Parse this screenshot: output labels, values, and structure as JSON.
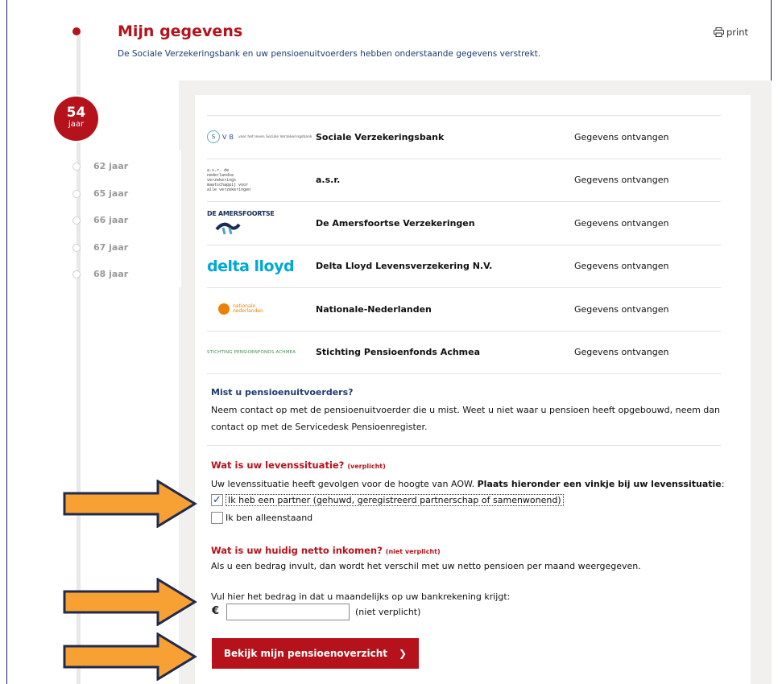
{
  "header": {
    "title": "Mijn gegevens",
    "subtitle": "De Sociale Verzekeringsbank en uw pensioenuitvoerders hebben onderstaande gegevens verstrekt.",
    "print_label": "print"
  },
  "timeline": {
    "current_age": "54",
    "current_unit": "jaar",
    "ages": [
      "62 jaar",
      "65 jaar",
      "66 jaar",
      "67 jaar",
      "68 jaar"
    ]
  },
  "providers": [
    {
      "logo": "svb-logo",
      "name": "Sociale Verzekeringsbank",
      "status": "Gegevens ontvangen"
    },
    {
      "logo": "asr-logo",
      "name": "a.s.r.",
      "status": "Gegevens ontvangen"
    },
    {
      "logo": "amersfoortse-logo",
      "name": "De Amersfoortse Verzekeringen",
      "status": "Gegevens ontvangen"
    },
    {
      "logo": "delta-lloyd-logo",
      "name": "Delta Lloyd Levensverzekering N.V.",
      "status": "Gegevens ontvangen"
    },
    {
      "logo": "nn-logo",
      "name": "Nationale-Nederlanden",
      "status": "Gegevens ontvangen"
    },
    {
      "logo": "achmea-logo",
      "name": "Stichting Pensioenfonds Achmea",
      "status": "Gegevens ontvangen"
    }
  ],
  "logos": {
    "svb_letters": [
      "S",
      "V",
      "B"
    ],
    "svb_small": "voor het leven Sociale Verzekeringsbank",
    "asr_text": "a.s.r. de nederlandse verzekerings maatschappij voor alle verzekeringen",
    "amersfoortse_text": "DE AMERSFOORTSE",
    "delta_text": "delta lloyd",
    "nn_text": "nationale nederlanden",
    "achmea_text": "STICHTING PENSIOENFONDS ACHMEA"
  },
  "missing": {
    "heading": "Mist u pensioenuitvoerders?",
    "body": "Neem contact op met de pensioenuitvoerder die u mist. Weet u niet waar u pensioen heeft opgebouwd, neem dan contact op met de Servicedesk Pensioenregister."
  },
  "life_situation": {
    "heading": "Wat is uw levenssituatie?",
    "required": "(verplicht)",
    "body_normal": "Uw levenssituatie heeft gevolgen voor de hoogte van AOW. ",
    "body_bold": "Plaats hieronder een vinkje bij uw levenssituatie",
    "body_end": ":",
    "option_partner": "Ik heb een partner (gehuwd, geregistreerd partnerschap of samenwonend)",
    "option_partner_checked": true,
    "option_single": "Ik ben alleenstaand",
    "option_single_checked": false,
    "check_mark": "✓"
  },
  "income": {
    "heading": "Wat is uw huidig netto inkomen?",
    "optional": "(niet verplicht)",
    "body": "Als u een bedrag invult, dan wordt het verschil met uw netto pensioen per maand weergegeven.",
    "amount_label": "Vul hier het bedrag in dat u maandelijks op uw bankrekening krijgt:",
    "currency": "€",
    "amount_value": "",
    "amount_note": "(niet verplicht)"
  },
  "cta": {
    "label": "Bekijk mijn pensioenoverzicht",
    "chevron": "❯"
  },
  "colors": {
    "brand_red": "#b5121b",
    "navy": "#1f3b73",
    "arrow_orange": "#f7a034",
    "arrow_border": "#1f2a4d"
  }
}
